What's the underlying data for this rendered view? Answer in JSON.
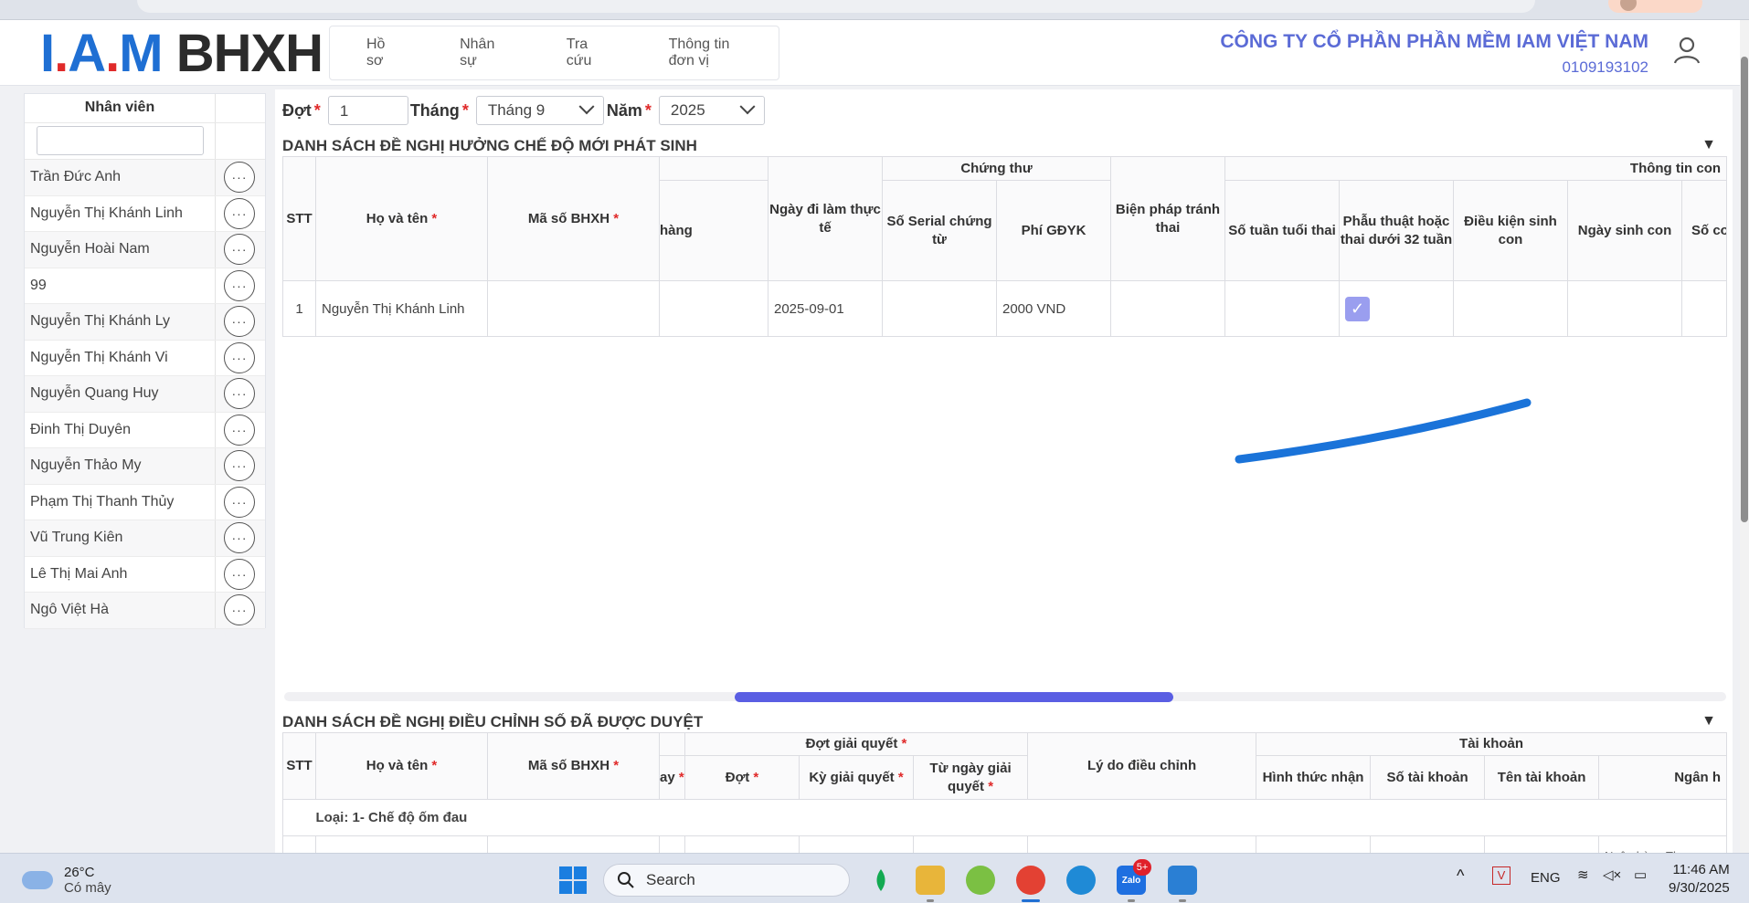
{
  "logo": {
    "part1": "I",
    "dot1": ".",
    "part2": "A",
    "dot2": ".",
    "part3": "M",
    "part4": "BHXH"
  },
  "nav": [
    "Hồ sơ",
    "Nhân sự",
    "Tra cứu",
    "Thông tin đơn vị"
  ],
  "company": {
    "name": "CÔNG TY CỔ PHẦN PHẦN MỀM IAM VIỆT NAM",
    "tax_code": "0109193102"
  },
  "sidebar": {
    "header": "Nhân viên",
    "filter_value": "",
    "employees": [
      "Trần Đức Anh",
      "Nguyễn Thị Khánh Linh",
      "Nguyễn Hoài Nam",
      "99",
      "Nguyễn Thị Khánh Ly",
      "Nguyễn Thị Khánh Vi",
      "Nguyễn Quang Huy",
      "Đinh Thị Duyên",
      "Nguyễn Thảo My",
      "Phạm Thị Thanh Thủy",
      "Vũ Trung Kiên",
      "Lê Thị Mai Anh",
      "Ngô Việt Hà"
    ],
    "more_glyph": "···"
  },
  "filters": {
    "dot_label": "Đợt",
    "dot_value": "1",
    "thang_label": "Tháng",
    "thang_value": "Tháng 9",
    "nam_label": "Năm",
    "nam_value": "2025",
    "req": "*"
  },
  "section1": {
    "title": "DANH SÁCH ĐỀ NGHỊ HƯỞNG CHẾ ĐỘ MỚI PHÁT SINH",
    "group_headers": {
      "chung_thu": "Chứng thư",
      "thong_tin_con": "Thông tin con"
    },
    "headers": {
      "stt": "STT",
      "ho_ten": "Họ và tên",
      "ma_so": "Mã số BHXH",
      "hang": "hàng",
      "ngay_di_lam": "Ngày đi làm thực tế",
      "serial": "Số Serial chứng từ",
      "phi": "Phí GĐYK",
      "bien_phap": "Biện pháp tránh thai",
      "so_tuan": "Số tuần tuổi thai",
      "phau_thuat": "Phẫu thuật hoặc thai dưới 32 tuần",
      "dieu_kien": "Điều kiện sinh con",
      "ngay_sinh": "Ngày sinh con",
      "so_con": "Số co"
    },
    "rows": [
      {
        "stt": "1",
        "ho_ten": "Nguyễn Thị Khánh Linh",
        "ma_so": "",
        "hang": "",
        "ngay_di_lam": "2025-09-01",
        "serial": "",
        "phi": "2000 VND",
        "bien_phap": "",
        "so_tuan": "",
        "phau_thuat_checked": true,
        "dieu_kien": "",
        "ngay_sinh": "",
        "so_con": ""
      }
    ]
  },
  "section2": {
    "title": "DANH SÁCH ĐỀ NGHỊ ĐIỀU CHỈNH SỐ ĐÃ ĐƯỢC DUYỆT",
    "group_headers": {
      "dot_giai_quyet": "Đợt giải quyết",
      "tai_khoan": "Tài khoản"
    },
    "headers": {
      "stt": "STT",
      "ho_ten": "Họ và tên",
      "ma_so": "Mã số BHXH",
      "ay": "ay",
      "dot": "Đợt",
      "ky": "Kỳ giải quyết",
      "tu_ngay": "Từ ngày giải quyết",
      "ly_do": "Lý do điều chỉnh",
      "hinh_thuc": "Hình thức nhận",
      "so_tk": "Số tài khoản",
      "ten_tk": "Tên tài khoản",
      "ngan_hang": "Ngân h"
    },
    "group_row": "Loại: 1- Chế độ ốm đau",
    "partial_cell": "Ngân hàng Thư"
  },
  "taskbar": {
    "temp": "26°C",
    "weather": "Có mây",
    "search": "Search",
    "lang": "ENG",
    "time": "11:46 AM",
    "date": "9/30/2025",
    "badge": "5+"
  },
  "colors": {
    "accent": "#5a5ee3",
    "brand_blue": "#1f6fd3",
    "brand_red": "#e02a2a",
    "company_text": "#5b6bd6"
  }
}
